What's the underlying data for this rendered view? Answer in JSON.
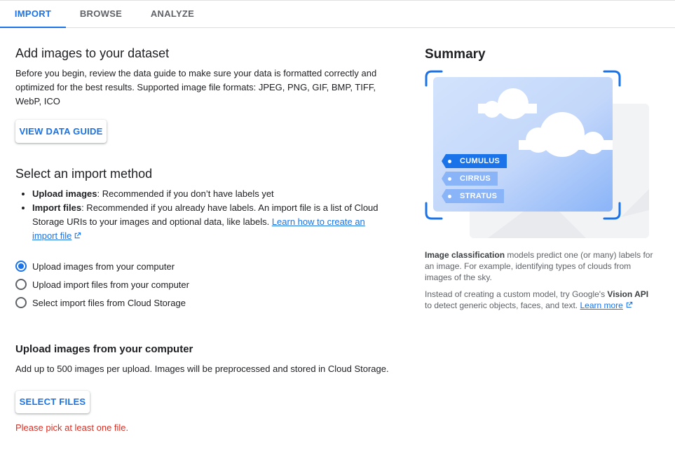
{
  "tabs": [
    {
      "label": "IMPORT",
      "active": true
    },
    {
      "label": "BROWSE",
      "active": false
    },
    {
      "label": "ANALYZE",
      "active": false
    }
  ],
  "add_images": {
    "title": "Add images to your dataset",
    "description": "Before you begin, review the data guide to make sure your data is formatted correctly and optimized for the best results. Supported image file formats: JPEG, PNG, GIF, BMP, TIFF, WebP, ICO",
    "view_guide_button": "VIEW DATA GUIDE"
  },
  "import_method": {
    "title": "Select an import method",
    "bullets": [
      {
        "bold": "Upload images",
        "text": ": Recommended if you don’t have labels yet"
      },
      {
        "bold": "Import files",
        "text": ": Recommended if you already have labels. An import file is a list of Cloud Storage URIs to your images and optional data, like labels. ",
        "link": "Learn how to create an import file"
      }
    ],
    "options": [
      {
        "label": "Upload images from your computer",
        "checked": true
      },
      {
        "label": "Upload import files from your computer",
        "checked": false
      },
      {
        "label": "Select import files from Cloud Storage",
        "checked": false
      }
    ]
  },
  "upload": {
    "title": "Upload images from your computer",
    "description": "Add up to 500 images per upload. Images will be preprocessed and stored in Cloud Storage.",
    "select_button": "SELECT FILES",
    "error": "Please pick at least one file."
  },
  "summary": {
    "title": "Summary",
    "tags": [
      "CUMULUS",
      "CIRRUS",
      "STRATUS"
    ],
    "para1_bold": "Image classification",
    "para1_rest": " models predict one (or many) labels for an image. For example, identifying types of clouds from images of the sky.",
    "para2_start": "Instead of creating a custom model, try Google's ",
    "para2_bold": "Vision API",
    "para2_rest": " to detect generic objects, faces, and text. ",
    "para2_link": "Learn more"
  },
  "colors": {
    "accent": "#1a73e8",
    "error": "#d93025",
    "tag_active": "#1a73e8",
    "tag_inactive": "#8ab4f8"
  },
  "icons": [
    "open-in-new-icon",
    "cloud-icon",
    "radio-checked-icon",
    "radio-unchecked-icon"
  ]
}
